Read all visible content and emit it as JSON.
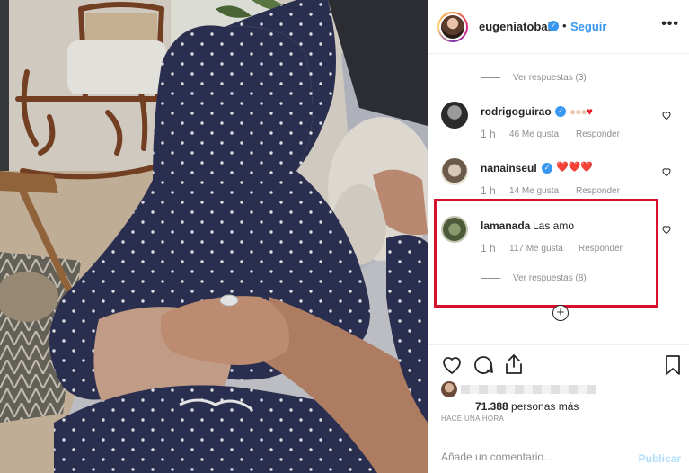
{
  "post": {
    "owner": "eugeniatobal",
    "separator": "•",
    "follow_label": "Seguir",
    "more_label": "•••"
  },
  "comments": {
    "top_replies_label": "Ver respuestas (3)",
    "items": [
      {
        "user": "rodrigoguirao",
        "verified": true,
        "text": "",
        "time": "1 h",
        "likes": "46 Me gusta",
        "reply_label": "Responder"
      },
      {
        "user": "nanainseul",
        "verified": true,
        "text": "",
        "emoji": "❤️❤️❤️",
        "time": "1 h",
        "likes": "14 Me gusta",
        "reply_label": "Responder"
      },
      {
        "user": "lamanada",
        "verified": false,
        "text": "Las amo",
        "time": "1 h",
        "likes": "117 Me gusta",
        "reply_label": "Responder",
        "replies_label": "Ver respuestas (8)"
      }
    ],
    "load_more_label": "+"
  },
  "actions": {
    "likes_count": "71.388",
    "likes_suffix": " personas más",
    "time_ago": "HACE UNA HORA",
    "comment_placeholder": "Añade un comentario...",
    "publish_label": "Publicar"
  },
  "colors": {
    "accent": "#3897f0",
    "highlight": "#d6102d",
    "muted": "#8e8e8e",
    "heart": "#ed1c24"
  }
}
